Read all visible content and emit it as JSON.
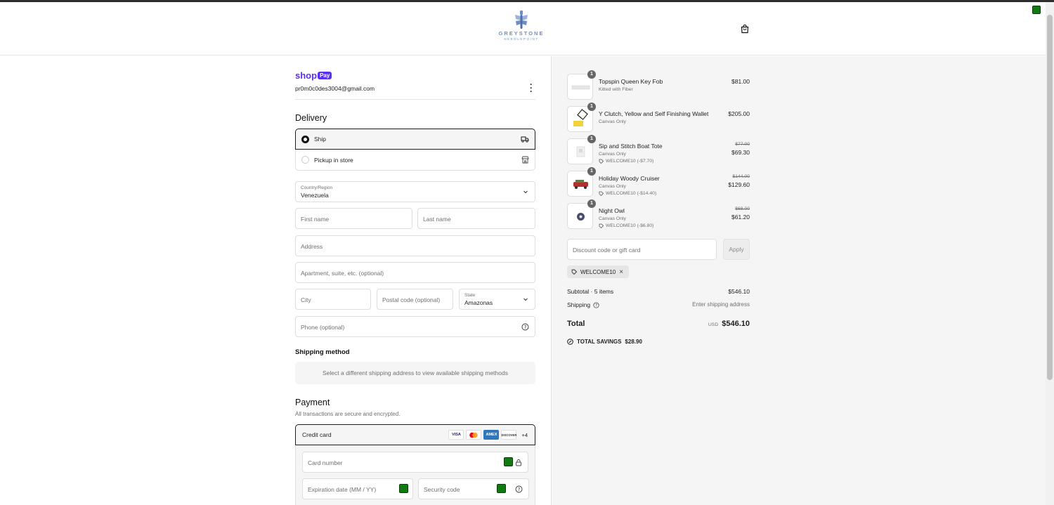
{
  "header": {
    "brand": "GREYSTONE",
    "brand_sub": "NEEDLEPOINT"
  },
  "shop_pay": {
    "logo_text": "shop",
    "pay_badge": "Pay",
    "email": "pr0m0c0des3004@gmail.com"
  },
  "delivery": {
    "title": "Delivery",
    "options": [
      {
        "label": "Ship",
        "selected": true,
        "icon": "truck-icon"
      },
      {
        "label": "Pickup in store",
        "selected": false,
        "icon": "store-icon"
      }
    ],
    "country_label": "Country/Region",
    "country_value": "Venezuela",
    "first_name_placeholder": "First name",
    "last_name_placeholder": "Last name",
    "address_placeholder": "Address",
    "apartment_placeholder": "Apartment, suite, etc. (optional)",
    "city_placeholder": "City",
    "postal_placeholder": "Postal code (optional)",
    "state_label": "State",
    "state_value": "Amazonas",
    "phone_placeholder": "Phone (optional)"
  },
  "shipping_method": {
    "title": "Shipping method",
    "note": "Select a different shipping address to view available shipping methods"
  },
  "payment": {
    "title": "Payment",
    "subtitle": "All transactions are secure and encrypted.",
    "method_label": "Credit card",
    "card_icons": [
      "VISA",
      "mastercard",
      "AMEX",
      "DISCOVER"
    ],
    "more_cards": "+4",
    "card_number_placeholder": "Card number",
    "expiration_placeholder": "Expiration date (MM / YY)",
    "security_placeholder": "Security code"
  },
  "order": {
    "items": [
      {
        "qty": "1",
        "name": "Topspin Queen Key Fob",
        "variant": "Kitted with Fiber",
        "price": "$81.00"
      },
      {
        "qty": "1",
        "name": "Y Clutch, Yellow and Self Finishing Wallet",
        "variant": "Canvas Only",
        "price": "$205.00"
      },
      {
        "qty": "1",
        "name": "Sip and Stitch Boat Tote",
        "variant": "Canvas Only",
        "discount": "WELCOME10 (-$7.70)",
        "old_price": "$77.00",
        "price": "$69.30"
      },
      {
        "qty": "1",
        "name": "Holiday Woody Cruiser",
        "variant": "Canvas Only",
        "discount": "WELCOME10 (-$14.40)",
        "old_price": "$144.00",
        "price": "$129.60"
      },
      {
        "qty": "1",
        "name": "Night Owl",
        "variant": "Canvas Only",
        "discount": "WELCOME10 (-$6.80)",
        "old_price": "$68.00",
        "price": "$61.20"
      }
    ],
    "discount_placeholder": "Discount code or gift card",
    "apply_label": "Apply",
    "applied_code": "WELCOME10",
    "subtotal_label": "Subtotal · 5 items",
    "subtotal_value": "$546.10",
    "shipping_label": "Shipping",
    "shipping_value": "Enter shipping address",
    "total_label": "Total",
    "currency": "USD",
    "total_value": "$546.10",
    "savings_label": "TOTAL SAVINGS",
    "savings_value": "$28.90"
  },
  "colors": {
    "shop_pay": "#5a31f4",
    "brand": "#6f8fc4",
    "green_marker": "#127a12"
  }
}
